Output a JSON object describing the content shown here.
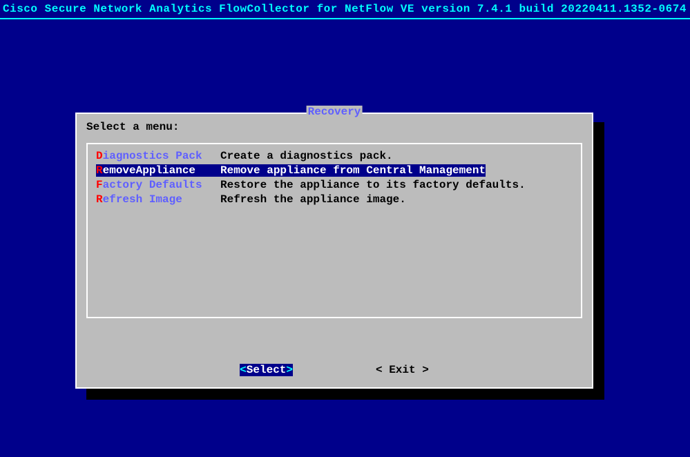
{
  "header": {
    "title": "Cisco Secure Network Analytics FlowCollector for NetFlow VE version 7.4.1 build 20220411.1352-0674"
  },
  "dialog": {
    "title": "Recovery",
    "prompt": "Select a menu:",
    "menu": [
      {
        "hotkey": "D",
        "rest": "iagnostics Pack",
        "desc": "Create a diagnostics pack.",
        "selected": false
      },
      {
        "hotkey": "R",
        "rest": "emoveAppliance",
        "desc": "Remove appliance from Central Management",
        "selected": true
      },
      {
        "hotkey": "F",
        "rest": "actory Defaults",
        "desc": "Restore the appliance to its factory defaults.",
        "selected": false
      },
      {
        "hotkey": "R",
        "rest": "efresh Image",
        "desc": "Refresh the appliance image.",
        "selected": false
      }
    ],
    "buttons": {
      "select": "Select",
      "exit": "Exit"
    }
  }
}
